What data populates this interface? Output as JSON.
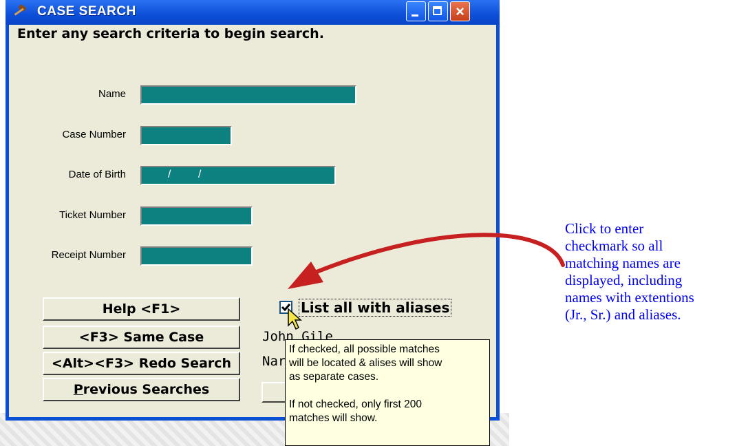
{
  "window": {
    "title": "CASE SEARCH",
    "controls": {
      "minimize": "minimize",
      "maximize": "maximize",
      "close": "×"
    }
  },
  "heading": "Enter any search criteria to begin search.",
  "fields": {
    "name_label": "Name",
    "case_number_label": "Case Number",
    "dob_label": "Date of Birth",
    "dob_slash": "/",
    "ticket_number_label": "Ticket Number",
    "receipt_number_label": "Receipt Number"
  },
  "buttons": {
    "help": "Help <F1>",
    "same_case": "<F3> Same Case",
    "redo_search": "<Alt><F3> Redo Search",
    "previous_searches_first": "P",
    "previous_searches_rest": "revious Searches"
  },
  "aliases_checkbox": {
    "label": "List all with aliases",
    "checked": true
  },
  "result_text": {
    "line1": "John Gile",
    "line2": "Nar"
  },
  "tooltip": {
    "line1": "If checked, all possible matches",
    "line2": "will be located & alises will show",
    "line3": "as separate cases.",
    "line4": "If not checked, only first 200",
    "line5": "matches will show."
  },
  "annotation": {
    "line1": "Click to enter",
    "line2": "checkmark so all",
    "line3": "matching names are",
    "line4": "displayed, including",
    "line5": "names with extentions",
    "line6": "(Jr., Sr.) and aliases."
  },
  "colors": {
    "titlebar": "#0d4fd8",
    "client_bg": "#ecead8",
    "field_fill": "#0d8080",
    "tooltip_bg": "#ffffe1",
    "annotation_text": "#0000ee",
    "arrow": "#c62020"
  },
  "icons": {
    "title": "gavel-icon",
    "cursor": "pointer-cursor-icon",
    "arrow": "curved-arrow-icon"
  }
}
